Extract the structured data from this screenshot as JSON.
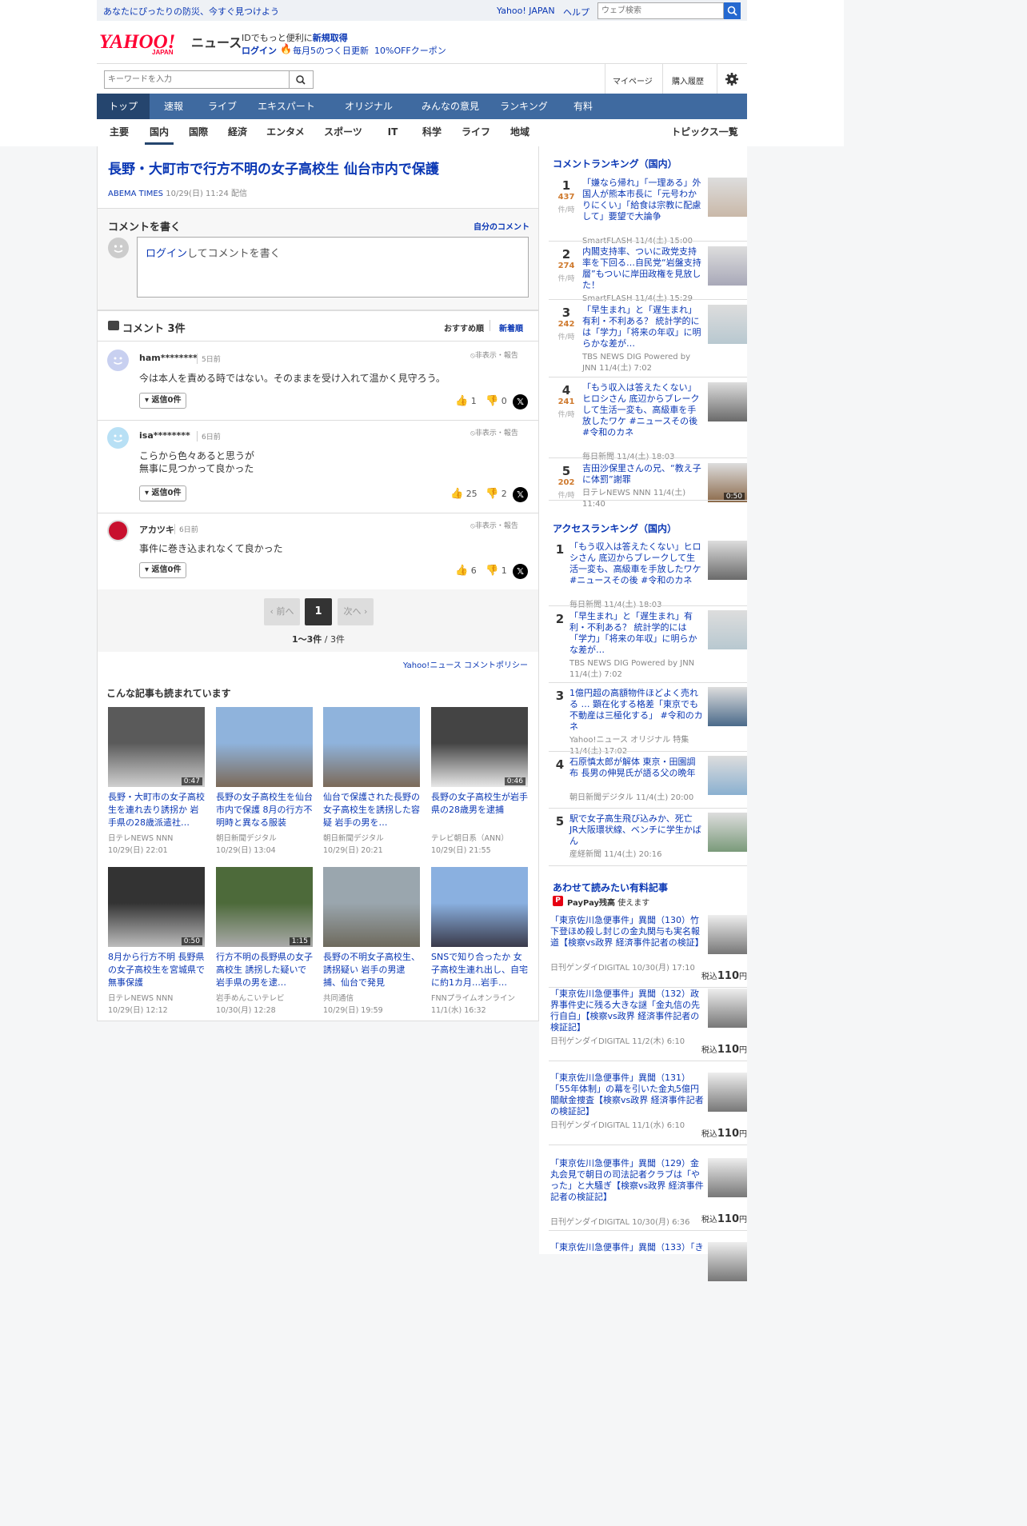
{
  "topbar": {
    "promo": "あなたにぴったりの防災、今すぐ見つけよう",
    "yahoo_japan": "Yahoo! JAPAN",
    "help": "ヘルプ",
    "search_placeholder": "ウェブ検索"
  },
  "header": {
    "logo": "YAHOO! JAPAN",
    "logo_sub": "ニュース",
    "id_text": "IDでもっと便利に",
    "signup": "新規取得",
    "login": "ログイン",
    "campaign": "毎月5のつく日更新",
    "coupon": "10%OFFクーポン"
  },
  "search": {
    "placeholder": "キーワードを入力"
  },
  "user_links": {
    "mypage": "マイページ",
    "history": "購入履歴"
  },
  "nav": [
    "トップ",
    "速報",
    "ライブ",
    "エキスパート",
    "オリジナル",
    "みんなの意見",
    "ランキング",
    "有料"
  ],
  "categories": [
    "主要",
    "国内",
    "国際",
    "経済",
    "エンタメ",
    "スポーツ",
    "IT",
    "科学",
    "ライフ",
    "地域"
  ],
  "topics_link": "トピックス一覧",
  "article": {
    "title": "長野・大町市で行方不明の女子高校生 仙台市内で保護",
    "source": "ABEMA TIMES",
    "datetime": "10/29(日) 11:24",
    "delivery": "配信"
  },
  "write_comment": {
    "heading": "コメントを書く",
    "my_comments": "自分のコメント",
    "login_link": "ログイン",
    "placeholder": "してコメントを書く"
  },
  "comments_section": {
    "label": "コメント 3件",
    "sort_recommended": "おすすめ順",
    "sort_new": "新着順",
    "hide_report": "非表示・報告"
  },
  "comments": [
    {
      "user": "ham********",
      "time": "5日前",
      "lines": [
        "今は本人を責める時ではない。そのままを受け入れて温かく見守ろう。"
      ],
      "replies": "返信0件",
      "likes": "1",
      "dislikes": "0",
      "avatar_color": "#c8d0f0"
    },
    {
      "user": "isa********",
      "time": "6日前",
      "lines": [
        "こらから色々あると思うが",
        "無事に見つかって良かった"
      ],
      "replies": "返信0件",
      "likes": "25",
      "dislikes": "2",
      "avatar_color": "#b8e0f5"
    },
    {
      "user": "アカツキ",
      "time": "6日前",
      "lines": [
        "事件に巻き込まれなくて良かった"
      ],
      "replies": "返信0件",
      "likes": "6",
      "dislikes": "1",
      "avatar_color": "#c8102e"
    }
  ],
  "pager": {
    "prev": "前へ",
    "page": "1",
    "next": "次へ",
    "range": "1〜3件",
    "total": "3件"
  },
  "comment_policy": "Yahoo!ニュース コメントポリシー",
  "related": {
    "heading": "こんな記事も読まれています",
    "items": [
      {
        "title": "長野・大町市の女子高校生を連れ去り誘拐か 岩手県の28歳派遣社…",
        "src": "日テレNEWS NNN",
        "date": "10/29(日) 22:01",
        "dur": "0:47",
        "c1": "#5a5a5a",
        "c2": "#d0d0d0"
      },
      {
        "title": "長野の女子高校生を仙台市内で保護 8月の行方不明時と異なる服装",
        "src": "朝日新聞デジタル",
        "date": "10/29(日) 13:04",
        "dur": "",
        "c1": "#8fb3dc",
        "c2": "#7c6a58"
      },
      {
        "title": "仙台で保護された長野の女子高校生を誘拐した容疑 岩手の男を…",
        "src": "朝日新聞デジタル",
        "date": "10/29(日) 20:21",
        "dur": "",
        "c1": "#8fb3dc",
        "c2": "#7c6a58"
      },
      {
        "title": "長野の女子高校生が岩手県の28歳男を逮捕",
        "src": "テレビ朝日系（ANN）",
        "date": "10/29(日) 21:55",
        "dur": "0:46",
        "c1": "#444",
        "c2": "#e8e8e8"
      },
      {
        "title": "8月から行方不明 長野県の女子高校生を宮城県で無事保護",
        "src": "日テレNEWS NNN",
        "date": "10/29(日) 12:12",
        "dur": "0:50",
        "c1": "#333",
        "c2": "#bdbdbd"
      },
      {
        "title": "行方不明の長野県の女子高校生 誘拐した疑いで岩手県の男を逮…",
        "src": "岩手めんこいテレビ",
        "date": "10/30(月) 12:28",
        "dur": "1:15",
        "c1": "#4d6a3a",
        "c2": "#aaa"
      },
      {
        "title": "長野の不明女子高校生、誘拐疑い 岩手の男逮捕、仙台で発見",
        "src": "共同通信",
        "date": "10/29(日) 19:59",
        "dur": "",
        "c1": "#9aa6ae",
        "c2": "#6e6a5d"
      },
      {
        "title": "SNSで知り合ったか 女子高校生連れ出し、自宅に約1カ月…岩手…",
        "src": "FNNプライムオンライン",
        "date": "11/1(水) 16:32",
        "dur": "",
        "c1": "#8ab0e0",
        "c2": "#3a3a4a"
      }
    ]
  },
  "comment_ranking": {
    "heading": "コメントランキング（国内）",
    "unit": "件/時",
    "items": [
      {
        "rank": "1",
        "count": "437",
        "title": "「嫌なら帰れ」「一理ある」外国人が熊本市長に「元号わかりにくい」「給食は宗教に配慮して」要望で大論争",
        "src": "SmartFLASH 11/4(土) 15:00"
      },
      {
        "rank": "2",
        "count": "274",
        "title": "内閣支持率、ついに政党支持率を下回る…自民党“岩盤支持層”もついに岸田政権を見放した！",
        "src": "SmartFLASH 11/4(土) 15:29"
      },
      {
        "rank": "3",
        "count": "242",
        "title": "「早生まれ」と「遅生まれ」有利・不利ある？ 統計学的には「学力」「将来の年収」に明らかな差が…",
        "src": "TBS NEWS DIG Powered by JNN 11/4(土) 7:02"
      },
      {
        "rank": "4",
        "count": "241",
        "title": "「もう収入は答えたくない」ヒロシさん 底辺からブレークして生活一変も、高級車を手放したワケ #ニュースその後 #令和のカネ",
        "src": "毎日新聞 11/4(土) 18:03"
      },
      {
        "rank": "5",
        "count": "202",
        "title": "吉田沙保里さんの兄、“教え子に体罰”謝罪",
        "src": "日テレNEWS NNN 11/4(土) 11:40",
        "dur": "0:50"
      }
    ]
  },
  "access_ranking": {
    "heading": "アクセスランキング（国内）",
    "items": [
      {
        "rank": "1",
        "title": "「もう収入は答えたくない」ヒロシさん 底辺からブレークして生活一変も、高級車を手放したワケ #ニュースその後 #令和のカネ",
        "src": "毎日新聞 11/4(土) 18:03"
      },
      {
        "rank": "2",
        "title": "「早生まれ」と「遅生まれ」有利・不利ある？ 統計学的には「学力」「将来の年収」に明らかな差が…",
        "src": "TBS NEWS DIG Powered by JNN 11/4(土) 7:02"
      },
      {
        "rank": "3",
        "title": "1億円超の高額物件ほどよく売れる … 顕在化する格差「東京でも不動産は三極化する」 #令和のカネ",
        "src": "Yahoo!ニュース オリジナル 特集 11/4(土) 17:02"
      },
      {
        "rank": "4",
        "title": "石原慎太郎が解体 東京・田園調布 長男の伸晃氏が語る父の晩年",
        "src": "朝日新聞デジタル 11/4(土) 20:00"
      },
      {
        "rank": "5",
        "title": "駅で女子高生飛び込みか、死亡 JR大阪環状線、ベンチに学生かばん",
        "src": "産経新聞 11/4(土) 20:16"
      }
    ]
  },
  "paid": {
    "heading": "あわせて読みたい有料記事",
    "paypay": "PayPay残高",
    "paypay_suffix": "使えます",
    "price_prefix": "税込",
    "price": "110",
    "price_unit": "円",
    "items": [
      {
        "title": "「東京佐川急便事件」異聞（130）竹下登ほめ殺し封じの金丸関与も実名報道【検察vs政界 経済事件記者の検証】",
        "src": "日刊ゲンダイDIGITAL 10/30(月) 17:10"
      },
      {
        "title": "「東京佐川急便事件」異聞（132）政界事件史に残る大きな謎「金丸信の先行自白」【検察vs政界 経済事件記者の検証記】",
        "src": "日刊ゲンダイDIGITAL 11/2(木) 6:10"
      },
      {
        "title": "「東京佐川急便事件」異聞（131）「55年体制」の幕を引いた金丸5億円闇献金捜査【検察vs政界 経済事件記者の検証記】",
        "src": "日刊ゲンダイDIGITAL 11/1(水) 6:10"
      },
      {
        "title": "「東京佐川急便事件」異聞（129）金丸会見で朝日の司法記者クラブは「やった」と大騒ぎ【検察vs政界 経済事件記者の検証記】",
        "src": "日刊ゲンダイDIGITAL 10/30(月) 6:36"
      },
      {
        "title": "「東京佐川急便事件」異聞（133）「き",
        "src": ""
      }
    ]
  }
}
